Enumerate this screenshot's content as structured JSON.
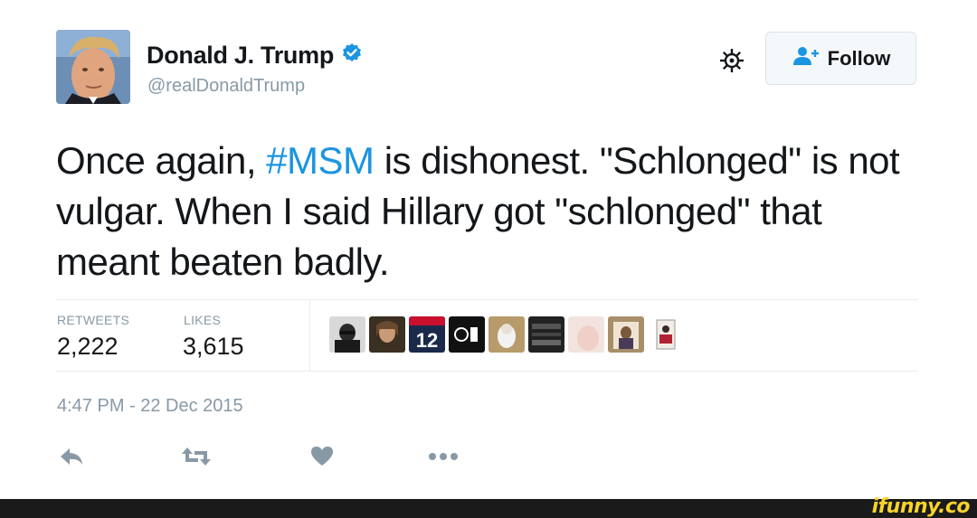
{
  "header": {
    "display_name": "Donald J. Trump",
    "handle": "@realDonaldTrump",
    "follow_label": "Follow",
    "verified_icon": "verified-badge-icon",
    "settings_icon": "gear-icon",
    "follow_icon": "add-user-icon"
  },
  "tweet": {
    "segments": [
      {
        "text": "Once again, ",
        "type": "text"
      },
      {
        "text": "#MSM",
        "type": "hashtag"
      },
      {
        "text": " is dishonest. \"Schlonged\" is not vulgar. When I said Hillary got \"schlonged\" that meant beaten badly.",
        "type": "text"
      }
    ]
  },
  "stats": {
    "retweets_label": "RETWEETS",
    "retweets_value": "2,222",
    "likes_label": "LIKES",
    "likes_value": "3,615",
    "liker_avatars_count": 9
  },
  "timestamp": "4:47 PM - 22 Dec 2015",
  "actions": {
    "reply_icon": "reply-icon",
    "retweet_icon": "retweet-icon",
    "like_icon": "heart-icon",
    "more_icon": "more-dots-icon"
  },
  "watermark": "ifunny.co",
  "colors": {
    "accent": "#1b95e0",
    "muted": "#8899a6",
    "text": "#14171a",
    "watermark": "#f8d32a"
  }
}
